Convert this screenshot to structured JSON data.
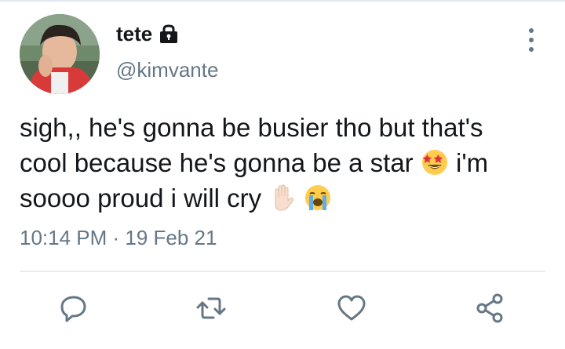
{
  "tweet": {
    "display_name": "tete",
    "handle": "@kimvante",
    "text_line1": "sigh,, he's gonna be busier tho but that's",
    "text_line2": "cool because he's gonna be a star",
    "text_line2_after": "i'm",
    "text_line3": "soooo proud i will cry",
    "timestamp": "10:14 PM · 19 Feb 21"
  },
  "icons": {
    "lock": "lock-icon",
    "more": "more-vertical-icon",
    "reply": "reply-icon",
    "retweet": "retweet-icon",
    "like": "heart-icon",
    "share": "share-icon",
    "emoji1": "star-struck-emoji",
    "emoji2": "raised-hand-emoji",
    "emoji3": "loudly-crying-emoji"
  },
  "colors": {
    "text": "#14171a",
    "secondary": "#657786",
    "divider": "#e6ecf0"
  }
}
